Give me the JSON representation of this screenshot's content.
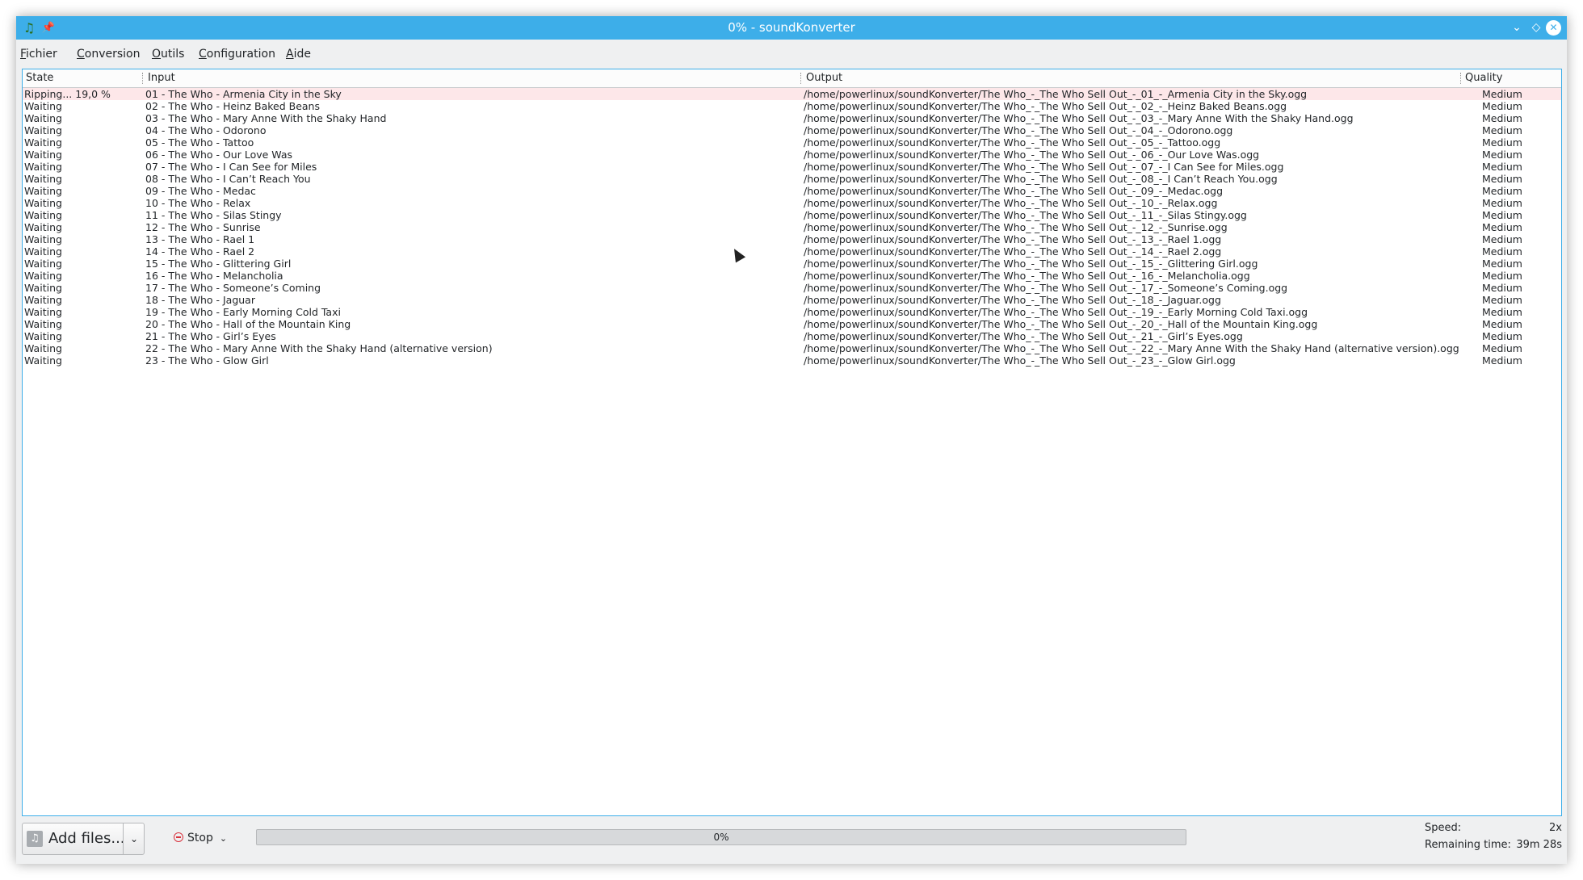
{
  "window": {
    "title": "0% - soundKonverter",
    "icons": {
      "app": "soundkonverter-app-icon",
      "pin": "pin-icon",
      "minimize": "chevron-down-icon",
      "maximize": "diamond-icon",
      "close": "close-icon"
    },
    "accent_color": "#3daee9"
  },
  "menu": {
    "items": [
      {
        "u": "F",
        "rest": "ichier"
      },
      {
        "u": "C",
        "rest": "onversion"
      },
      {
        "u": "O",
        "rest": "utils"
      },
      {
        "u": "C",
        "rest": "onfiguration"
      },
      {
        "u": "A",
        "rest": "ide"
      }
    ]
  },
  "table": {
    "headers": {
      "state": "State",
      "input": "Input",
      "output": "Output",
      "quality": "Quality"
    },
    "active_row_color": "#fde7e9",
    "rows": [
      {
        "state": "Ripping... 19,0 %",
        "input": "01 - The Who - Armenia City in the Sky",
        "output": "/home/powerlinux/soundKonverter/The Who_-_The Who Sell Out_-_01_-_Armenia City in the Sky.ogg",
        "quality": "Medium"
      },
      {
        "state": "Waiting",
        "input": "02 - The Who - Heinz Baked Beans",
        "output": "/home/powerlinux/soundKonverter/The Who_-_The Who Sell Out_-_02_-_Heinz Baked Beans.ogg",
        "quality": "Medium"
      },
      {
        "state": "Waiting",
        "input": "03 - The Who - Mary Anne With the Shaky Hand",
        "output": "/home/powerlinux/soundKonverter/The Who_-_The Who Sell Out_-_03_-_Mary Anne With the Shaky Hand.ogg",
        "quality": "Medium"
      },
      {
        "state": "Waiting",
        "input": "04 - The Who - Odorono",
        "output": "/home/powerlinux/soundKonverter/The Who_-_The Who Sell Out_-_04_-_Odorono.ogg",
        "quality": "Medium"
      },
      {
        "state": "Waiting",
        "input": "05 - The Who - Tattoo",
        "output": "/home/powerlinux/soundKonverter/The Who_-_The Who Sell Out_-_05_-_Tattoo.ogg",
        "quality": "Medium"
      },
      {
        "state": "Waiting",
        "input": "06 - The Who - Our Love Was",
        "output": "/home/powerlinux/soundKonverter/The Who_-_The Who Sell Out_-_06_-_Our Love Was.ogg",
        "quality": "Medium"
      },
      {
        "state": "Waiting",
        "input": "07 - The Who - I Can See for Miles",
        "output": "/home/powerlinux/soundKonverter/The Who_-_The Who Sell Out_-_07_-_I Can See for Miles.ogg",
        "quality": "Medium"
      },
      {
        "state": "Waiting",
        "input": "08 - The Who - I Can’t Reach You",
        "output": "/home/powerlinux/soundKonverter/The Who_-_The Who Sell Out_-_08_-_I Can’t Reach You.ogg",
        "quality": "Medium"
      },
      {
        "state": "Waiting",
        "input": "09 - The Who - Medac",
        "output": "/home/powerlinux/soundKonverter/The Who_-_The Who Sell Out_-_09_-_Medac.ogg",
        "quality": "Medium"
      },
      {
        "state": "Waiting",
        "input": "10 - The Who - Relax",
        "output": "/home/powerlinux/soundKonverter/The Who_-_The Who Sell Out_-_10_-_Relax.ogg",
        "quality": "Medium"
      },
      {
        "state": "Waiting",
        "input": "11 - The Who - Silas Stingy",
        "output": "/home/powerlinux/soundKonverter/The Who_-_The Who Sell Out_-_11_-_Silas Stingy.ogg",
        "quality": "Medium"
      },
      {
        "state": "Waiting",
        "input": "12 - The Who - Sunrise",
        "output": "/home/powerlinux/soundKonverter/The Who_-_The Who Sell Out_-_12_-_Sunrise.ogg",
        "quality": "Medium"
      },
      {
        "state": "Waiting",
        "input": "13 - The Who - Rael 1",
        "output": "/home/powerlinux/soundKonverter/The Who_-_The Who Sell Out_-_13_-_Rael 1.ogg",
        "quality": "Medium"
      },
      {
        "state": "Waiting",
        "input": "14 - The Who - Rael 2",
        "output": "/home/powerlinux/soundKonverter/The Who_-_The Who Sell Out_-_14_-_Rael 2.ogg",
        "quality": "Medium"
      },
      {
        "state": "Waiting",
        "input": "15 - The Who - Glittering Girl",
        "output": "/home/powerlinux/soundKonverter/The Who_-_The Who Sell Out_-_15_-_Glittering Girl.ogg",
        "quality": "Medium"
      },
      {
        "state": "Waiting",
        "input": "16 - The Who - Melancholia",
        "output": "/home/powerlinux/soundKonverter/The Who_-_The Who Sell Out_-_16_-_Melancholia.ogg",
        "quality": "Medium"
      },
      {
        "state": "Waiting",
        "input": "17 - The Who - Someone’s Coming",
        "output": "/home/powerlinux/soundKonverter/The Who_-_The Who Sell Out_-_17_-_Someone’s Coming.ogg",
        "quality": "Medium"
      },
      {
        "state": "Waiting",
        "input": "18 - The Who - Jaguar",
        "output": "/home/powerlinux/soundKonverter/The Who_-_The Who Sell Out_-_18_-_Jaguar.ogg",
        "quality": "Medium"
      },
      {
        "state": "Waiting",
        "input": "19 - The Who - Early Morning Cold Taxi",
        "output": "/home/powerlinux/soundKonverter/The Who_-_The Who Sell Out_-_19_-_Early Morning Cold Taxi.ogg",
        "quality": "Medium"
      },
      {
        "state": "Waiting",
        "input": "20 - The Who - Hall of the Mountain King",
        "output": "/home/powerlinux/soundKonverter/The Who_-_The Who Sell Out_-_20_-_Hall of the Mountain King.ogg",
        "quality": "Medium"
      },
      {
        "state": "Waiting",
        "input": "21 - The Who - Girl’s Eyes",
        "output": "/home/powerlinux/soundKonverter/The Who_-_The Who Sell Out_-_21_-_Girl’s Eyes.ogg",
        "quality": "Medium"
      },
      {
        "state": "Waiting",
        "input": "22 - The Who - Mary Anne With the Shaky Hand (alternative version)",
        "output": "/home/powerlinux/soundKonverter/The Who_-_The Who Sell Out_-_22_-_Mary Anne With the Shaky Hand (alternative version).ogg",
        "quality": "Medium"
      },
      {
        "state": "Waiting",
        "input": "23 - The Who - Glow Girl",
        "output": "/home/powerlinux/soundKonverter/The Who_-_The Who Sell Out_-_23_-_Glow Girl.ogg",
        "quality": "Medium"
      }
    ]
  },
  "bottom": {
    "add_files_label": "Add files...",
    "add_files_icon": "music-file-icon",
    "stop_label": "Stop",
    "stop_icon": "stop-circle-icon",
    "progress_text": "0%",
    "progress_value": 0.0,
    "speed_label": "Speed:",
    "speed_value": "2x",
    "remaining_label": "Remaining time:",
    "remaining_value": "39m 28s"
  }
}
